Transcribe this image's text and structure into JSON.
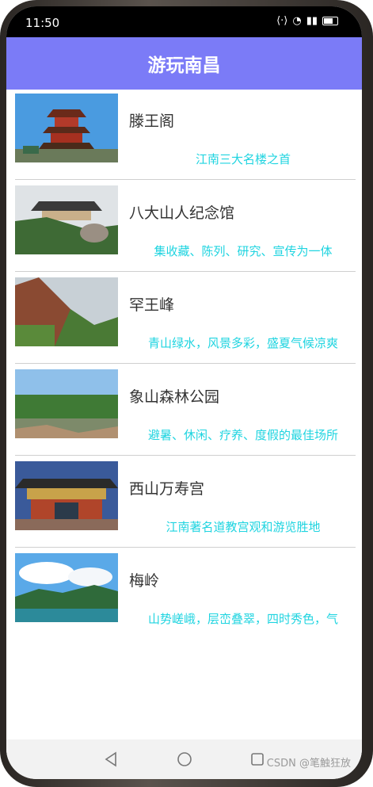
{
  "status": {
    "time": "11:50"
  },
  "header": {
    "title": "游玩南昌"
  },
  "items": [
    {
      "name": "滕王阁",
      "desc": "江南三大名楼之首"
    },
    {
      "name": "八大山人纪念馆",
      "desc": "集收藏、陈列、研究、宣传为一体"
    },
    {
      "name": "罕王峰",
      "desc": "青山绿水，风景多彩，盛夏气候凉爽"
    },
    {
      "name": "象山森林公园",
      "desc": "避暑、休闲、疗养、度假的最佳场所"
    },
    {
      "name": "西山万寿宫",
      "desc": "江南著名道教宫观和游览胜地"
    },
    {
      "name": "梅岭",
      "desc": "山势嵯峨，层峦叠翠，四时秀色，气"
    }
  ],
  "watermark": "CSDN @笔触狂放",
  "colors": {
    "appbar": "#7b7bf7",
    "desc_text": "#1fd4e0"
  }
}
